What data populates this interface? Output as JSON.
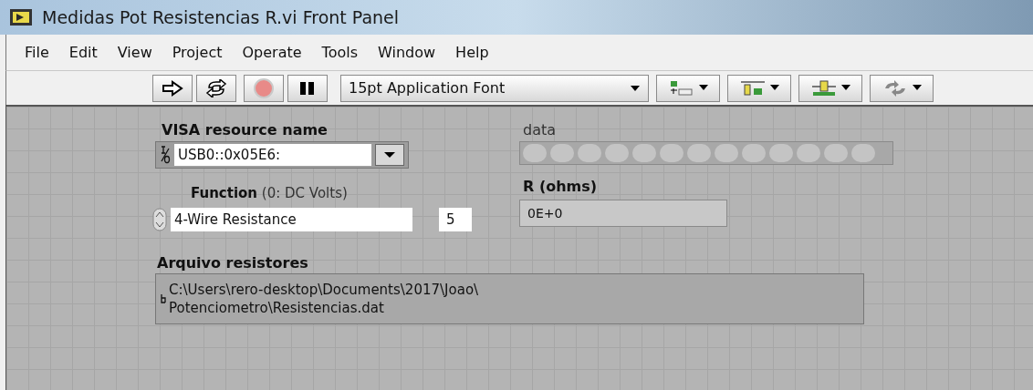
{
  "window": {
    "title": "Medidas Pot Resistencias R.vi Front Panel"
  },
  "menu": [
    "File",
    "Edit",
    "View",
    "Project",
    "Operate",
    "Tools",
    "Window",
    "Help"
  ],
  "toolbar": {
    "font": "15pt Application Font"
  },
  "panel": {
    "visa": {
      "label": "VISA resource name",
      "value": "USB0::0x05E6:"
    },
    "function": {
      "label": "Function",
      "label_note": "(0: DC Volts)",
      "value": "4-Wire Resistance",
      "number": "5"
    },
    "data": {
      "label": "data",
      "leds": [
        {
          "on": false
        },
        {
          "on": false
        },
        {
          "on": false
        },
        {
          "on": false
        },
        {
          "on": false
        },
        {
          "on": false
        },
        {
          "on": false
        },
        {
          "on": false
        },
        {
          "on": false
        },
        {
          "on": false
        },
        {
          "on": false
        },
        {
          "on": false
        },
        {
          "on": false
        }
      ]
    },
    "r": {
      "label": "R (ohms)",
      "value": "0E+0"
    },
    "file": {
      "label": "Arquivo resistores",
      "value_lines": [
        "C:\\Users\\rero-desktop\\Documents\\2017\\Joao\\",
        "Potenciometro\\Resistencias.dat"
      ]
    }
  }
}
